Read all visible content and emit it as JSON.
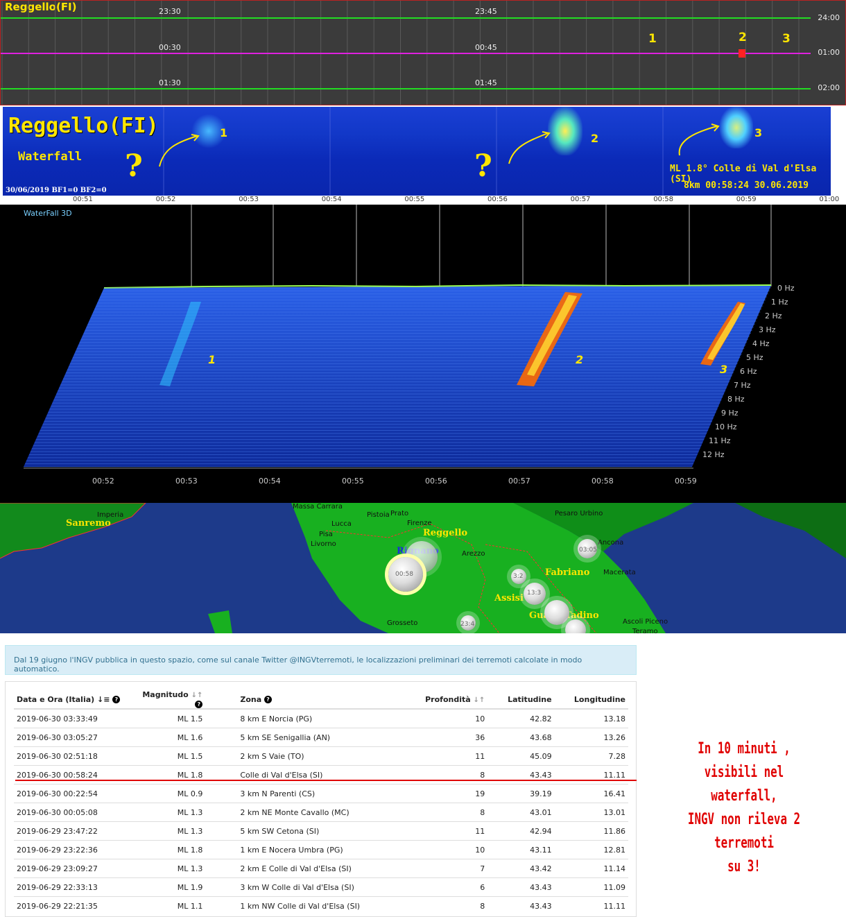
{
  "seismogram": {
    "station": "Reggello(FI)",
    "rows": [
      {
        "left_time": "23:30",
        "mid_time": "23:45",
        "hour_label": "24:00",
        "color": "#22dd22"
      },
      {
        "left_time": "00:30",
        "mid_time": "00:45",
        "hour_label": "01:00",
        "color": "#e020e0"
      },
      {
        "left_time": "01:30",
        "mid_time": "01:45",
        "hour_label": "02:00",
        "color": "#22dd22"
      }
    ],
    "events": [
      "1",
      "2",
      "3"
    ]
  },
  "waterfall2d": {
    "title": "Reggello(FI)",
    "subtitle": "Waterfall",
    "status": "30/06/2019 BF1=0 BF2=0",
    "question_mark": "?",
    "event_labels": [
      "1",
      "2",
      "3"
    ],
    "quake_info_line1": "ML 1.8° Colle di Val d'Elsa (SI)",
    "quake_info_line2": "8km 00:58:24 30.06.2019",
    "time_ticks": [
      "00:51",
      "00:52",
      "00:53",
      "00:54",
      "00:55",
      "00:56",
      "00:57",
      "00:58",
      "00:59",
      "01:00"
    ]
  },
  "waterfall3d": {
    "title": "WaterFall 3D",
    "event_labels": [
      "1",
      "2",
      "3"
    ],
    "freq_labels": [
      "0 Hz",
      "1 Hz",
      "2 Hz",
      "3 Hz",
      "4 Hz",
      "5 Hz",
      "6 Hz",
      "7 Hz",
      "8 Hz",
      "9 Hz",
      "10 Hz",
      "11 Hz",
      "12 Hz"
    ],
    "time_ticks": [
      "00:52",
      "00:53",
      "00:54",
      "00:55",
      "00:56",
      "00:57",
      "00:58",
      "00:59"
    ]
  },
  "map": {
    "cities": [
      "Massa Carrara",
      "Prato",
      "Lucca",
      "Pistoia",
      "Firenze",
      "Pisa",
      "Livorno",
      "Arezzo",
      "Imperia",
      "Pesaro Urbino",
      "Ancona",
      "Macerata",
      "Grosseto",
      "Ascoli Piceno",
      "Teramo"
    ],
    "regions": {
      "sanremo": "Sanremo",
      "reggello": "Reggello",
      "rignano": "Rignano",
      "fabriano": "Fabriano",
      "assisi": "Assisi",
      "gualdo": "GualdoTadino"
    },
    "quake_labels": {
      "main": "00:58",
      "ancona": "03:05",
      "assisi1": "3:2",
      "assisi2": "13:3",
      "grosseto": "23:4"
    }
  },
  "notice": "Dal 19 giugno l'INGV pubblica in questo spazio, come sul canale Twitter @INGVterremoti, le localizzazioni preliminari dei terremoti calcolate in modo automatico.",
  "table": {
    "headers": {
      "datetime": "Data e Ora (Italia)",
      "magnitude": "Magnitudo",
      "zone": "Zona",
      "depth": "Profondità",
      "lat": "Latitudine",
      "lon": "Longitudine"
    },
    "rows": [
      {
        "datetime": "2019-06-30 03:33:49",
        "mag": "ML 1.5",
        "zone": "8 km E Norcia (PG)",
        "depth": "10",
        "lat": "42.82",
        "lon": "13.18"
      },
      {
        "datetime": "2019-06-30 03:05:27",
        "mag": "ML 1.6",
        "zone": "5 km SE Senigallia (AN)",
        "depth": "36",
        "lat": "43.68",
        "lon": "13.26"
      },
      {
        "datetime": "2019-06-30 02:51:18",
        "mag": "ML 1.5",
        "zone": "2 km S Vaie (TO)",
        "depth": "11",
        "lat": "45.09",
        "lon": "7.28"
      },
      {
        "datetime": "2019-06-30 00:58:24",
        "mag": "ML 1.8",
        "zone": "Colle di Val d'Elsa (SI)",
        "depth": "8",
        "lat": "43.43",
        "lon": "11.11"
      },
      {
        "datetime": "2019-06-30 00:22:54",
        "mag": "ML 0.9",
        "zone": "3 km N Parenti (CS)",
        "depth": "19",
        "lat": "39.19",
        "lon": "16.41"
      },
      {
        "datetime": "2019-06-30 00:05:08",
        "mag": "ML 1.3",
        "zone": "2 km NE Monte Cavallo (MC)",
        "depth": "8",
        "lat": "43.01",
        "lon": "13.01"
      },
      {
        "datetime": "2019-06-29 23:47:22",
        "mag": "ML 1.3",
        "zone": "5 km SW Cetona (SI)",
        "depth": "11",
        "lat": "42.94",
        "lon": "11.86"
      },
      {
        "datetime": "2019-06-29 23:22:36",
        "mag": "ML 1.8",
        "zone": "1 km E Nocera Umbra (PG)",
        "depth": "10",
        "lat": "43.11",
        "lon": "12.81"
      },
      {
        "datetime": "2019-06-29 23:09:27",
        "mag": "ML 1.3",
        "zone": "2 km E Colle di Val d'Elsa (SI)",
        "depth": "7",
        "lat": "43.42",
        "lon": "11.14"
      },
      {
        "datetime": "2019-06-29 22:33:13",
        "mag": "ML 1.9",
        "zone": "3 km W Colle di Val d'Elsa (SI)",
        "depth": "6",
        "lat": "43.43",
        "lon": "11.09"
      },
      {
        "datetime": "2019-06-29 22:21:35",
        "mag": "ML 1.1",
        "zone": "1 km NW Colle di Val d'Elsa (SI)",
        "depth": "8",
        "lat": "43.43",
        "lon": "11.11"
      }
    ]
  },
  "annotation": {
    "line1": "In 10 minuti , visibili nel waterfall,",
    "line2": "INGV non rileva 2 terremoti",
    "line3": "su 3!"
  }
}
